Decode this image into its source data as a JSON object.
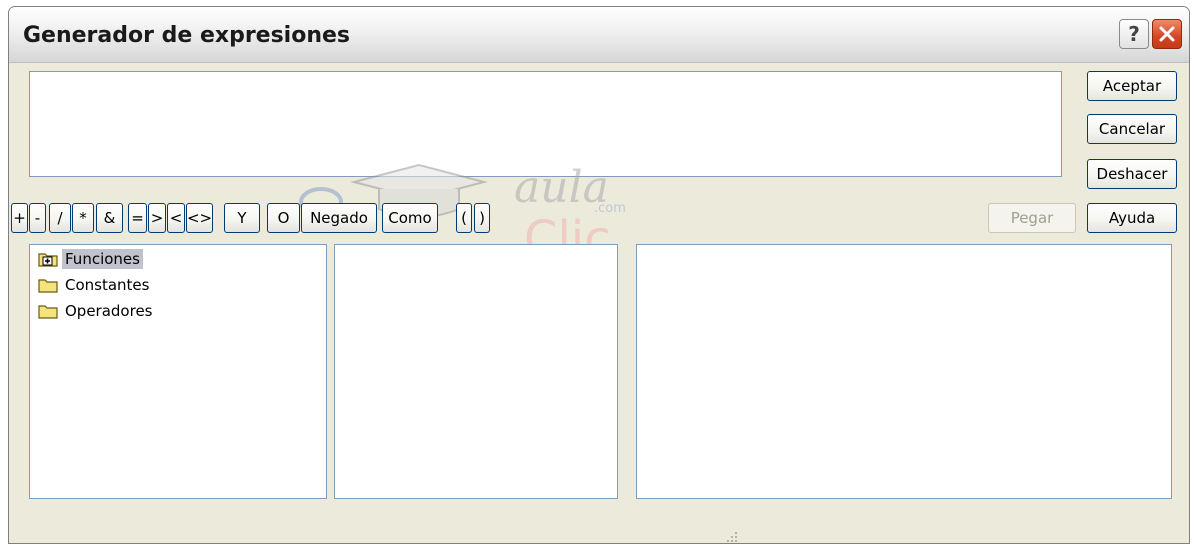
{
  "window": {
    "title": "Generador de expresiones",
    "help_label": "?",
    "close_label": "✕"
  },
  "expression_box": {
    "value": ""
  },
  "side_buttons": {
    "aceptar": "Aceptar",
    "cancelar": "Cancelar",
    "deshacer": "Deshacer",
    "ayuda": "Ayuda",
    "pegar": "Pegar"
  },
  "operators": [
    "+",
    "-",
    "/",
    "*",
    "&",
    "=",
    ">",
    "<",
    "<>",
    "Y",
    "O",
    "Negado",
    "Como",
    "(",
    ")"
  ],
  "tree": {
    "items": [
      {
        "label": "Funciones",
        "icon": "folder-plus-icon",
        "selected": true
      },
      {
        "label": "Constantes",
        "icon": "folder-icon",
        "selected": false
      },
      {
        "label": "Operadores",
        "icon": "folder-icon",
        "selected": false
      }
    ]
  },
  "watermark": {
    "line1": "aula",
    "line2": "Clic",
    "line3": ".com"
  },
  "colors": {
    "dialog_bg": "#ebeadb",
    "button_border": "#003c74",
    "field_border": "#7f9db9",
    "selection": "#c1c2cc",
    "close_red": "#d24623"
  }
}
